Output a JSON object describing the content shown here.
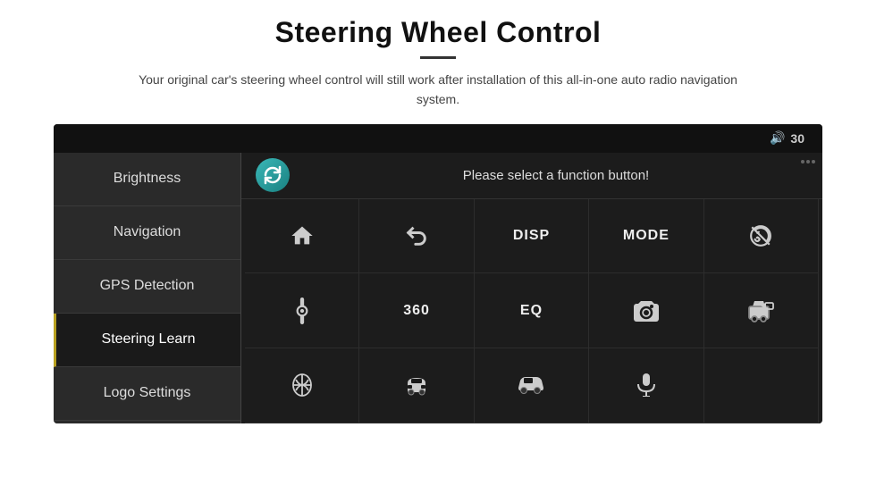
{
  "page": {
    "title": "Steering Wheel Control",
    "subtitle": "Your original car's steering wheel control will still work after installation of this all-in-one auto radio navigation system."
  },
  "screen": {
    "volume_label": "30",
    "prompt": "Please select a function button!",
    "menu_items": [
      {
        "id": "brightness",
        "label": "Brightness",
        "active": false
      },
      {
        "id": "navigation",
        "label": "Navigation",
        "active": false
      },
      {
        "id": "gps-detection",
        "label": "GPS Detection",
        "active": false
      },
      {
        "id": "steering-learn",
        "label": "Steering Learn",
        "active": true
      },
      {
        "id": "logo-settings",
        "label": "Logo Settings",
        "active": false
      }
    ],
    "grid_buttons": [
      {
        "id": "home",
        "type": "icon",
        "symbol": "home"
      },
      {
        "id": "back",
        "type": "icon",
        "symbol": "back"
      },
      {
        "id": "disp",
        "type": "text",
        "label": "DISP"
      },
      {
        "id": "mode",
        "type": "text",
        "label": "MODE"
      },
      {
        "id": "no-phone",
        "type": "icon",
        "symbol": "no-phone"
      },
      {
        "id": "settings-knob",
        "type": "icon",
        "symbol": "knob"
      },
      {
        "id": "360",
        "type": "text",
        "label": "360"
      },
      {
        "id": "eq",
        "type": "text",
        "label": "EQ"
      },
      {
        "id": "camera-front",
        "type": "icon",
        "symbol": "camera-1"
      },
      {
        "id": "camera-rear",
        "type": "icon",
        "symbol": "camera-2"
      },
      {
        "id": "car-top",
        "type": "icon",
        "symbol": "car-top"
      },
      {
        "id": "car-front",
        "type": "icon",
        "symbol": "car-front"
      },
      {
        "id": "car-side",
        "type": "icon",
        "symbol": "car-side"
      },
      {
        "id": "microphone",
        "type": "icon",
        "symbol": "mic"
      },
      {
        "id": "empty",
        "type": "empty"
      }
    ]
  }
}
